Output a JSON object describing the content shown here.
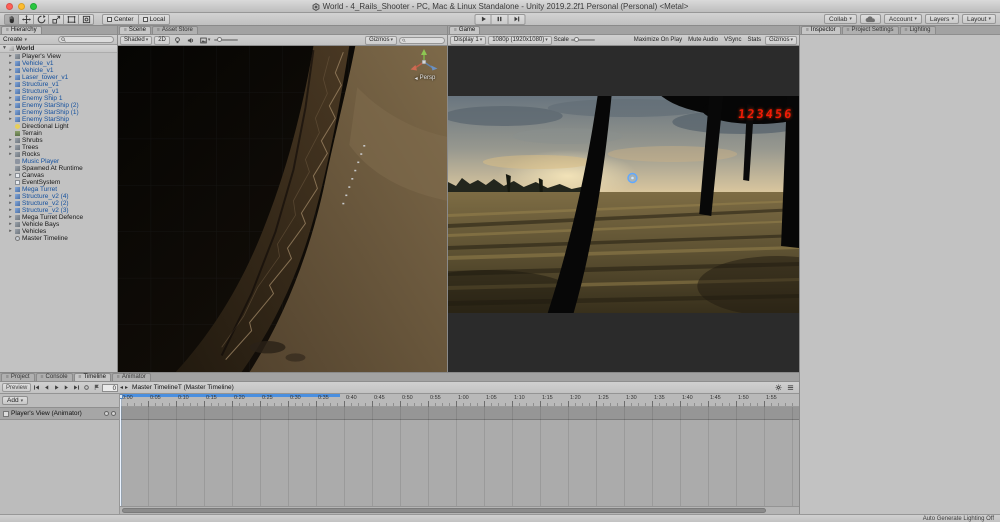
{
  "window": {
    "title": "World - 4_Rails_Shooter - PC, Mac & Linux Standalone - Unity 2019.2.2f1 Personal (Personal) <Metal>"
  },
  "icons": {
    "tab_handle": "≡",
    "dropdown": "▾",
    "arrow_collapsed": "▸",
    "arrow_expanded": "▼",
    "back": "◂",
    "forward": "▸"
  },
  "colors": {
    "accent_blue": "#4a8fe0",
    "prefab_text": "#14509e",
    "hud_red": "#f21b07"
  },
  "toolbar": {
    "pivot": "Center",
    "space": "Local",
    "collab": "Collab",
    "account": "Account",
    "layers": "Layers",
    "layout": "Layout"
  },
  "hierarchy": {
    "tab": "Hierarchy",
    "create": "Create",
    "scene": "World",
    "items": [
      {
        "label": "Player's View",
        "prefab": false,
        "children": true,
        "icon": "cube"
      },
      {
        "label": "Vehicle_v1",
        "prefab": true,
        "children": true,
        "icon": "cube"
      },
      {
        "label": "Vehicle_v1",
        "prefab": true,
        "children": true,
        "icon": "cube"
      },
      {
        "label": "Laser_tower_v1",
        "prefab": true,
        "children": true,
        "icon": "cube"
      },
      {
        "label": "Structure_v1",
        "prefab": true,
        "children": true,
        "icon": "cube"
      },
      {
        "label": "Structure_v1",
        "prefab": true,
        "children": true,
        "icon": "cube"
      },
      {
        "label": "Enemy Ship 1",
        "prefab": true,
        "children": true,
        "icon": "cube"
      },
      {
        "label": "Enemy StarShip (2)",
        "prefab": true,
        "children": true,
        "icon": "cube"
      },
      {
        "label": "Enemy StarShip (1)",
        "prefab": true,
        "children": true,
        "icon": "cube"
      },
      {
        "label": "Enemy StarShip",
        "prefab": true,
        "children": true,
        "icon": "cube"
      },
      {
        "label": "Directional Light",
        "prefab": false,
        "children": false,
        "icon": "light"
      },
      {
        "label": "Terrain",
        "prefab": false,
        "children": false,
        "icon": "terrain"
      },
      {
        "label": "Shrubs",
        "prefab": false,
        "children": true,
        "icon": "cube"
      },
      {
        "label": "Trees",
        "prefab": false,
        "children": true,
        "icon": "cube"
      },
      {
        "label": "Rocks",
        "prefab": false,
        "children": true,
        "icon": "cube"
      },
      {
        "label": "Music Player",
        "prefab": true,
        "children": false,
        "icon": "audio"
      },
      {
        "label": "Spawned At Runtime",
        "prefab": false,
        "children": false,
        "icon": "cube"
      },
      {
        "label": "Canvas",
        "prefab": false,
        "children": true,
        "icon": "ui"
      },
      {
        "label": "EventSystem",
        "prefab": false,
        "children": false,
        "icon": "ui"
      },
      {
        "label": "Mega Turret",
        "prefab": true,
        "children": true,
        "icon": "cube"
      },
      {
        "label": "Structure_v2 (4)",
        "prefab": true,
        "children": true,
        "icon": "cube"
      },
      {
        "label": "Structure_v2 (2)",
        "prefab": true,
        "children": true,
        "icon": "cube"
      },
      {
        "label": "Structure_v2 (3)",
        "prefab": true,
        "children": true,
        "icon": "cube"
      },
      {
        "label": "Mega Turret Defence",
        "prefab": false,
        "children": true,
        "icon": "cube"
      },
      {
        "label": "Vehicle Bays",
        "prefab": false,
        "children": true,
        "icon": "cube"
      },
      {
        "label": "Vehicles",
        "prefab": false,
        "children": true,
        "icon": "cube"
      },
      {
        "label": "Master Timeline",
        "prefab": false,
        "children": false,
        "icon": "timeline"
      }
    ]
  },
  "scene_view": {
    "tab": "Scene",
    "asset_store_tab": "Asset Store",
    "shaded": "Shaded",
    "mode_2d": "2D",
    "gizmos": "Gizmos",
    "persp": "Persp"
  },
  "game_view": {
    "tab": "Game",
    "display": "Display 1",
    "resolution": "1080p (1920x1080)",
    "scale": "Scale",
    "maximize": "Maximize On Play",
    "mute": "Mute Audio",
    "vsync": "VSync",
    "stats": "Stats",
    "gizmos": "Gizmos",
    "hud_score": "123456"
  },
  "inspector": {
    "tabs": [
      "Inspector",
      "Project Settings",
      "Lighting"
    ]
  },
  "timeline": {
    "tabs": [
      "Project",
      "Console",
      "Timeline",
      "Animator"
    ],
    "preview": "Preview",
    "frame": "0",
    "breadcrumb": "Master TimelineT (Master Timeline)",
    "add": "Add",
    "track": "Player's View (Animator)",
    "ruler_labels": [
      "0:00",
      "0:05",
      "0:10",
      "0:15",
      "0:20",
      "0:25",
      "0:30",
      "0:35",
      "0:40",
      "0:45",
      "0:50",
      "0:55",
      "1:00",
      "1:05",
      "1:10",
      "1:15",
      "1:20",
      "1:25",
      "1:30",
      "1:35",
      "1:40",
      "1:45",
      "1:50",
      "1:55"
    ]
  },
  "statusbar": {
    "lighting": "Auto Generate Lighting Off"
  }
}
